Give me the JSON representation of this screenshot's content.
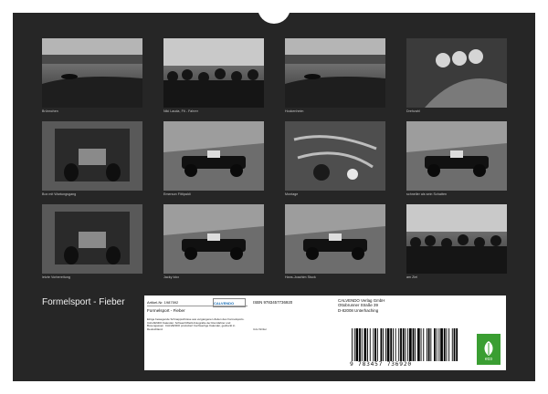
{
  "tiles": [
    {
      "caption": "Brünnchen",
      "icon": "race-track"
    },
    {
      "caption": "Niki Lauda, Fit - Fahrer",
      "icon": "crowd"
    },
    {
      "caption": "Hockenheim",
      "icon": "race-track"
    },
    {
      "caption": "Drehzahl",
      "icon": "gauge"
    },
    {
      "caption": "Box mit Wartungsgang",
      "icon": "garage"
    },
    {
      "caption": "Emerson Fittipaldi",
      "icon": "race-car"
    },
    {
      "caption": "Montage",
      "icon": "engine"
    },
    {
      "caption": "schneller als sein Schatten",
      "icon": "race-car"
    },
    {
      "caption": "letzte Vorbereitung",
      "icon": "garage"
    },
    {
      "caption": "Jacky Ickx",
      "icon": "race-car"
    },
    {
      "caption": "Hans-Joachim Stuck",
      "icon": "race-car"
    },
    {
      "caption": "am Ziel",
      "icon": "crowd"
    }
  ],
  "calendar_title": "Formelsport - Fieber",
  "info": {
    "article_label": "Artikel-Nr. 1987592",
    "logo_text": "CALVENDO",
    "product_title": "Formelsport - Fieber",
    "description": "Einige bewegende Schnappschüsse aus vergangenen Zeiten des Formelsports. CALVENDO Kalender. Schwarz/Weiß-Fotografie der Rennfahrer und Boxengassen. CALVENDO produziert hochwertige Kalender, gedruckt in Deutschland.",
    "isbn": "ISBN 9783457736920",
    "author": "Udo Wirtler",
    "publisher_lines": [
      "CALVENDO Verlag GmbH",
      "Ottobrunner Straße 39",
      "D-82008 Unterhaching"
    ],
    "barcode_number": "9 783457 736920",
    "eco_label": "eco"
  }
}
